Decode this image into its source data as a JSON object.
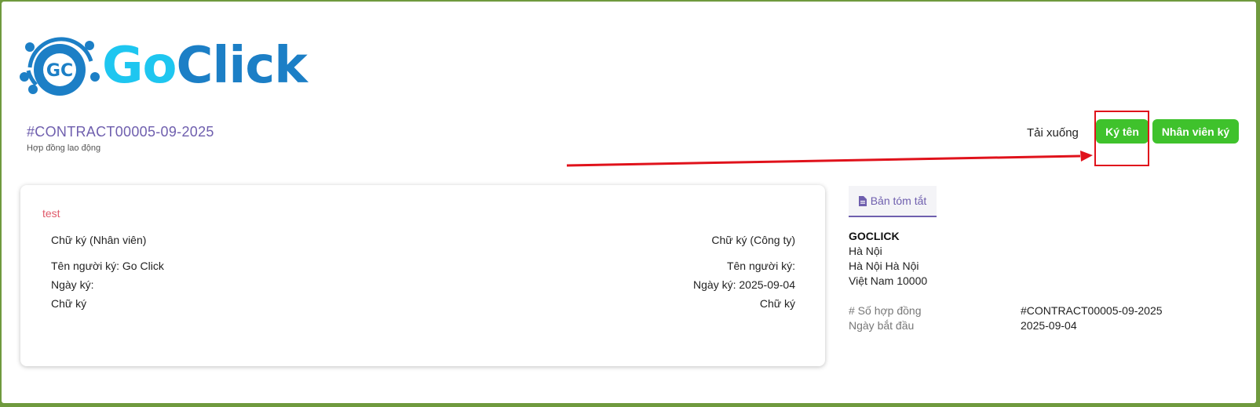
{
  "logo": {
    "text_go": "Go",
    "text_click": "Click",
    "monogram": "GC"
  },
  "header": {
    "contract_number": "#CONTRACT00005-09-2025",
    "contract_type": "Hợp đồng lao động"
  },
  "actions": {
    "download_label": "Tải xuống",
    "sign_label": "Ký tên",
    "employee_sign_label": "Nhân viên ký",
    "accent_color": "#3fc22c"
  },
  "annotation": {
    "highlight_color": "#e0121b"
  },
  "contract_body": {
    "title": "test",
    "employee": {
      "signature_heading": "Chữ ký (Nhân viên)",
      "signer_name": "Tên người ký: Go Click",
      "sign_date": "Ngày ký:",
      "signature_label": "Chữ ký"
    },
    "company": {
      "signature_heading": "Chữ ký (Công ty)",
      "signer_name": "Tên người ký:",
      "sign_date": "Ngày ký: 2025-09-04",
      "signature_label": "Chữ ký"
    }
  },
  "summary": {
    "tab_label": "Bản tóm tắt",
    "tab_icon": "file-icon",
    "company_name": "GOCLICK",
    "address_line1": "Hà Nội",
    "address_line2": "Hà Nội Hà Nội",
    "address_line3": "Việt Nam 10000",
    "fields": [
      {
        "label": "# Số hợp đồng",
        "value": "#CONTRACT00005-09-2025"
      },
      {
        "label": "Ngày bắt đầu",
        "value": "2025-09-04"
      }
    ]
  }
}
